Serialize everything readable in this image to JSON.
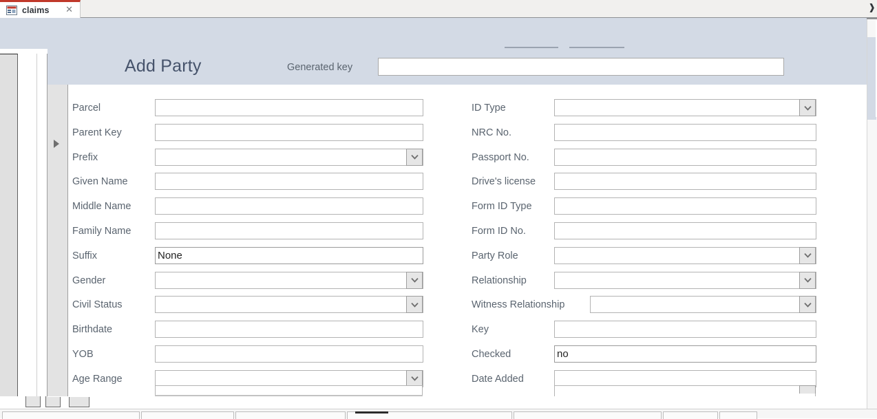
{
  "window": {
    "tab": {
      "label": "claims",
      "icon": "form-datasheet-icon",
      "close_icon": "close-icon"
    },
    "tabstrip_overflow_icon": "chevron-right-icon",
    "accent_color": "#c0392b",
    "header_band_color": "#d3dae5"
  },
  "form": {
    "title": "Add Party",
    "generated_key": {
      "label": "Generated key",
      "value": ""
    },
    "record_selector_icon": "record-current-triangle-icon",
    "dropdown_icon": "chevron-down-icon",
    "left_column": [
      {
        "label": "Parcel",
        "value": "",
        "type": "text"
      },
      {
        "label": "Parent Key",
        "value": "",
        "type": "text"
      },
      {
        "label": "Prefix",
        "value": "",
        "type": "combo"
      },
      {
        "label": "Given Name",
        "value": "",
        "type": "text"
      },
      {
        "label": "Middle Name",
        "value": "",
        "type": "text"
      },
      {
        "label": "Family Name",
        "value": "",
        "type": "text"
      },
      {
        "label": "Suffix",
        "value": "None",
        "type": "text"
      },
      {
        "label": "Gender",
        "value": "",
        "type": "combo"
      },
      {
        "label": "Civil Status",
        "value": "",
        "type": "combo"
      },
      {
        "label": "Birthdate",
        "value": "",
        "type": "text"
      },
      {
        "label": "YOB",
        "value": "",
        "type": "text"
      },
      {
        "label": "Age Range",
        "value": "",
        "type": "combo"
      }
    ],
    "right_column": [
      {
        "label": "ID Type",
        "value": "",
        "type": "combo"
      },
      {
        "label": "NRC No.",
        "value": "",
        "type": "text"
      },
      {
        "label": "Passport No.",
        "value": "",
        "type": "text"
      },
      {
        "label": "Drive's license",
        "value": "",
        "type": "text"
      },
      {
        "label": "Form ID Type",
        "value": "",
        "type": "text"
      },
      {
        "label": "Form ID No.",
        "value": "",
        "type": "text"
      },
      {
        "label": "Party Role",
        "value": "",
        "type": "combo"
      },
      {
        "label": "Relationship",
        "value": "",
        "type": "combo"
      },
      {
        "label": "Witness Relationship",
        "value": "",
        "type": "combo"
      },
      {
        "label": "Key",
        "value": "",
        "type": "text"
      },
      {
        "label": "Checked",
        "value": "no",
        "type": "text"
      },
      {
        "label": "Date Added",
        "value": "",
        "type": "text"
      }
    ]
  }
}
